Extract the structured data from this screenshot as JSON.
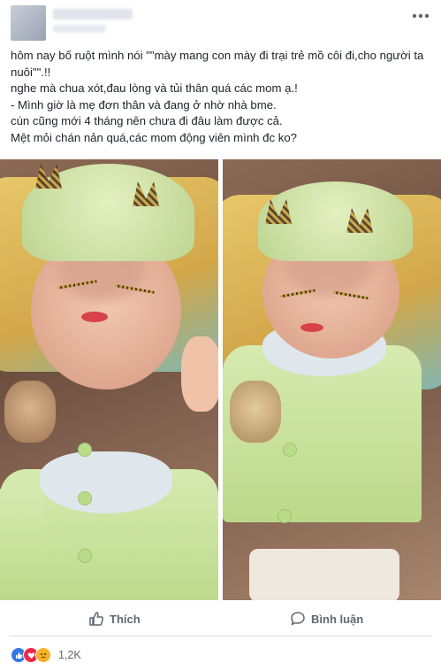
{
  "post": {
    "lines": [
      "hôm nay bố ruột mình nói \"\"mày mang con mày đi trại trẻ mồ côi đi,cho người ta nuôi\"\".!!",
      "nghe mà chua xót,đau lòng và tủi thân quá các mom ạ.!",
      "- Mình giờ là mẹ đơn thân và đang ở nhờ nhà bme.",
      "cún cũng mới 4 tháng nên chưa đi đâu làm được cả.",
      "Mệt mỏi chán nản quá,các mom động viên mình đc ko?"
    ]
  },
  "actions": {
    "like_label": "Thích",
    "comment_label": "Bình luận"
  },
  "reactions": {
    "icons": [
      "like-icon",
      "love-icon",
      "sad-icon"
    ],
    "count": "1,2K"
  },
  "icons": {
    "more": "more-options-icon"
  },
  "colors": {
    "action_text": "#606770",
    "like_reaction": "#3578e5",
    "love_reaction": "#f0284a",
    "sad_reaction": "#f7b125"
  }
}
